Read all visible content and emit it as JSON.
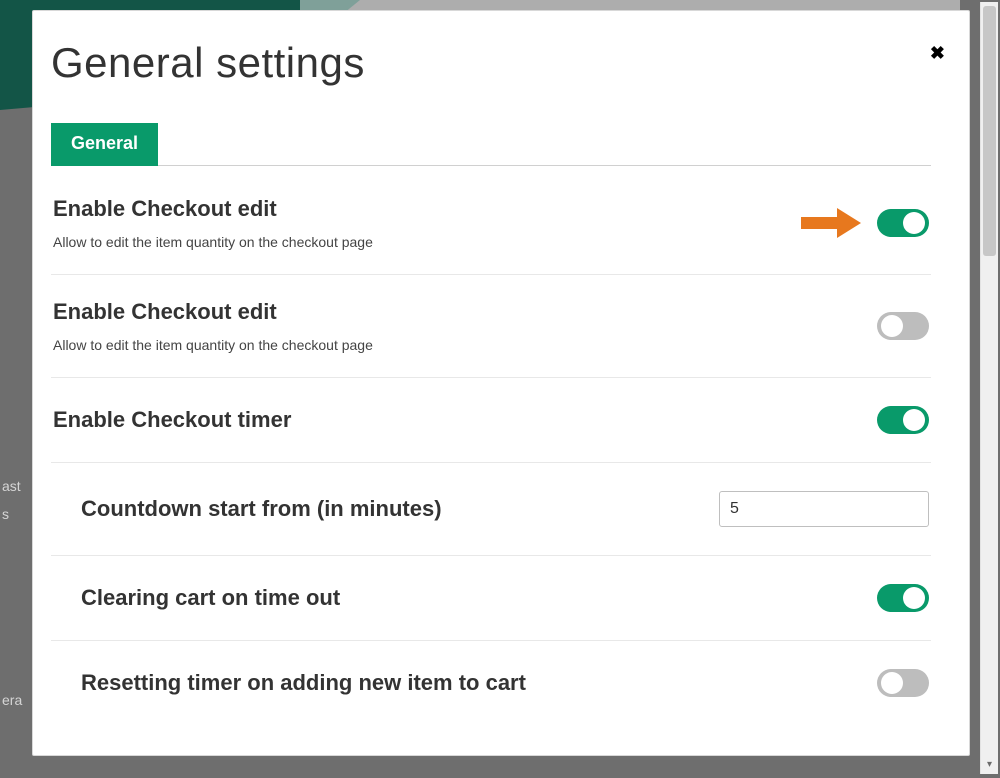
{
  "colors": {
    "accent": "#099a6a",
    "arrow": "#e7781e"
  },
  "background": {
    "side_words": [
      "ast",
      "s",
      "era"
    ]
  },
  "modal": {
    "title": "General settings",
    "close_glyph": "✖",
    "tabs": [
      {
        "label": "General"
      }
    ],
    "settings": [
      {
        "key": "enable_checkout_edit_1",
        "title": "Enable Checkout edit",
        "desc": "Allow to edit the item quantity on the checkout page",
        "type": "toggle",
        "value": true,
        "highlight_arrow": true
      },
      {
        "key": "enable_checkout_edit_2",
        "title": "Enable Checkout edit",
        "desc": "Allow to edit the item quantity on the checkout page",
        "type": "toggle",
        "value": false
      },
      {
        "key": "enable_checkout_timer",
        "title": "Enable Checkout timer",
        "type": "toggle",
        "value": true
      },
      {
        "key": "countdown_minutes",
        "title": "Countdown start from (in minutes)",
        "type": "number",
        "value": "5",
        "sub": true
      },
      {
        "key": "clear_cart_timeout",
        "title": "Clearing cart on time out",
        "type": "toggle",
        "value": true,
        "sub": true
      },
      {
        "key": "reset_timer_on_add",
        "title": "Resetting timer on adding new item to cart",
        "type": "toggle",
        "value": false,
        "sub": true
      }
    ]
  }
}
